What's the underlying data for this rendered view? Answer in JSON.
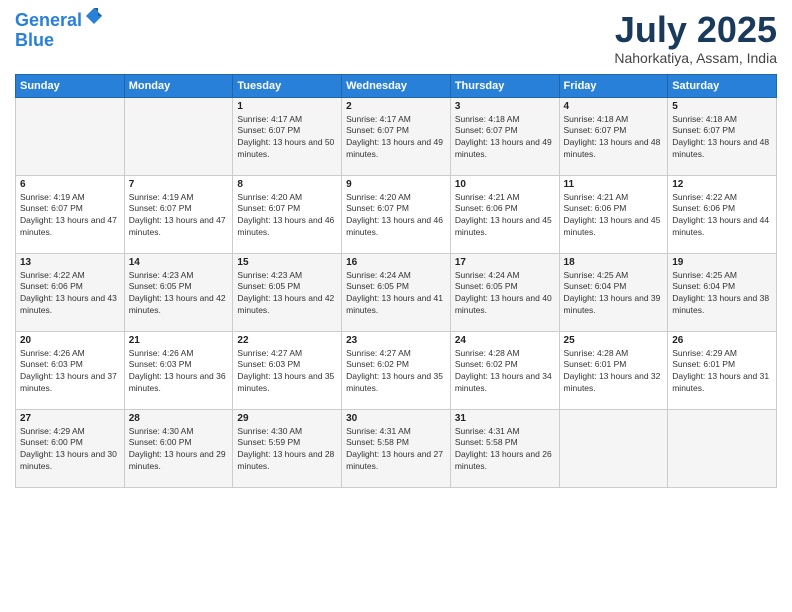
{
  "header": {
    "logo_line1": "General",
    "logo_line2": "Blue",
    "month": "July 2025",
    "location": "Nahorkatiya, Assam, India"
  },
  "weekdays": [
    "Sunday",
    "Monday",
    "Tuesday",
    "Wednesday",
    "Thursday",
    "Friday",
    "Saturday"
  ],
  "weeks": [
    [
      {
        "day": "",
        "text": ""
      },
      {
        "day": "",
        "text": ""
      },
      {
        "day": "1",
        "text": "Sunrise: 4:17 AM\nSunset: 6:07 PM\nDaylight: 13 hours and 50 minutes."
      },
      {
        "day": "2",
        "text": "Sunrise: 4:17 AM\nSunset: 6:07 PM\nDaylight: 13 hours and 49 minutes."
      },
      {
        "day": "3",
        "text": "Sunrise: 4:18 AM\nSunset: 6:07 PM\nDaylight: 13 hours and 49 minutes."
      },
      {
        "day": "4",
        "text": "Sunrise: 4:18 AM\nSunset: 6:07 PM\nDaylight: 13 hours and 48 minutes."
      },
      {
        "day": "5",
        "text": "Sunrise: 4:18 AM\nSunset: 6:07 PM\nDaylight: 13 hours and 48 minutes."
      }
    ],
    [
      {
        "day": "6",
        "text": "Sunrise: 4:19 AM\nSunset: 6:07 PM\nDaylight: 13 hours and 47 minutes."
      },
      {
        "day": "7",
        "text": "Sunrise: 4:19 AM\nSunset: 6:07 PM\nDaylight: 13 hours and 47 minutes."
      },
      {
        "day": "8",
        "text": "Sunrise: 4:20 AM\nSunset: 6:07 PM\nDaylight: 13 hours and 46 minutes."
      },
      {
        "day": "9",
        "text": "Sunrise: 4:20 AM\nSunset: 6:07 PM\nDaylight: 13 hours and 46 minutes."
      },
      {
        "day": "10",
        "text": "Sunrise: 4:21 AM\nSunset: 6:06 PM\nDaylight: 13 hours and 45 minutes."
      },
      {
        "day": "11",
        "text": "Sunrise: 4:21 AM\nSunset: 6:06 PM\nDaylight: 13 hours and 45 minutes."
      },
      {
        "day": "12",
        "text": "Sunrise: 4:22 AM\nSunset: 6:06 PM\nDaylight: 13 hours and 44 minutes."
      }
    ],
    [
      {
        "day": "13",
        "text": "Sunrise: 4:22 AM\nSunset: 6:06 PM\nDaylight: 13 hours and 43 minutes."
      },
      {
        "day": "14",
        "text": "Sunrise: 4:23 AM\nSunset: 6:05 PM\nDaylight: 13 hours and 42 minutes."
      },
      {
        "day": "15",
        "text": "Sunrise: 4:23 AM\nSunset: 6:05 PM\nDaylight: 13 hours and 42 minutes."
      },
      {
        "day": "16",
        "text": "Sunrise: 4:24 AM\nSunset: 6:05 PM\nDaylight: 13 hours and 41 minutes."
      },
      {
        "day": "17",
        "text": "Sunrise: 4:24 AM\nSunset: 6:05 PM\nDaylight: 13 hours and 40 minutes."
      },
      {
        "day": "18",
        "text": "Sunrise: 4:25 AM\nSunset: 6:04 PM\nDaylight: 13 hours and 39 minutes."
      },
      {
        "day": "19",
        "text": "Sunrise: 4:25 AM\nSunset: 6:04 PM\nDaylight: 13 hours and 38 minutes."
      }
    ],
    [
      {
        "day": "20",
        "text": "Sunrise: 4:26 AM\nSunset: 6:03 PM\nDaylight: 13 hours and 37 minutes."
      },
      {
        "day": "21",
        "text": "Sunrise: 4:26 AM\nSunset: 6:03 PM\nDaylight: 13 hours and 36 minutes."
      },
      {
        "day": "22",
        "text": "Sunrise: 4:27 AM\nSunset: 6:03 PM\nDaylight: 13 hours and 35 minutes."
      },
      {
        "day": "23",
        "text": "Sunrise: 4:27 AM\nSunset: 6:02 PM\nDaylight: 13 hours and 35 minutes."
      },
      {
        "day": "24",
        "text": "Sunrise: 4:28 AM\nSunset: 6:02 PM\nDaylight: 13 hours and 34 minutes."
      },
      {
        "day": "25",
        "text": "Sunrise: 4:28 AM\nSunset: 6:01 PM\nDaylight: 13 hours and 32 minutes."
      },
      {
        "day": "26",
        "text": "Sunrise: 4:29 AM\nSunset: 6:01 PM\nDaylight: 13 hours and 31 minutes."
      }
    ],
    [
      {
        "day": "27",
        "text": "Sunrise: 4:29 AM\nSunset: 6:00 PM\nDaylight: 13 hours and 30 minutes."
      },
      {
        "day": "28",
        "text": "Sunrise: 4:30 AM\nSunset: 6:00 PM\nDaylight: 13 hours and 29 minutes."
      },
      {
        "day": "29",
        "text": "Sunrise: 4:30 AM\nSunset: 5:59 PM\nDaylight: 13 hours and 28 minutes."
      },
      {
        "day": "30",
        "text": "Sunrise: 4:31 AM\nSunset: 5:58 PM\nDaylight: 13 hours and 27 minutes."
      },
      {
        "day": "31",
        "text": "Sunrise: 4:31 AM\nSunset: 5:58 PM\nDaylight: 13 hours and 26 minutes."
      },
      {
        "day": "",
        "text": ""
      },
      {
        "day": "",
        "text": ""
      }
    ]
  ]
}
